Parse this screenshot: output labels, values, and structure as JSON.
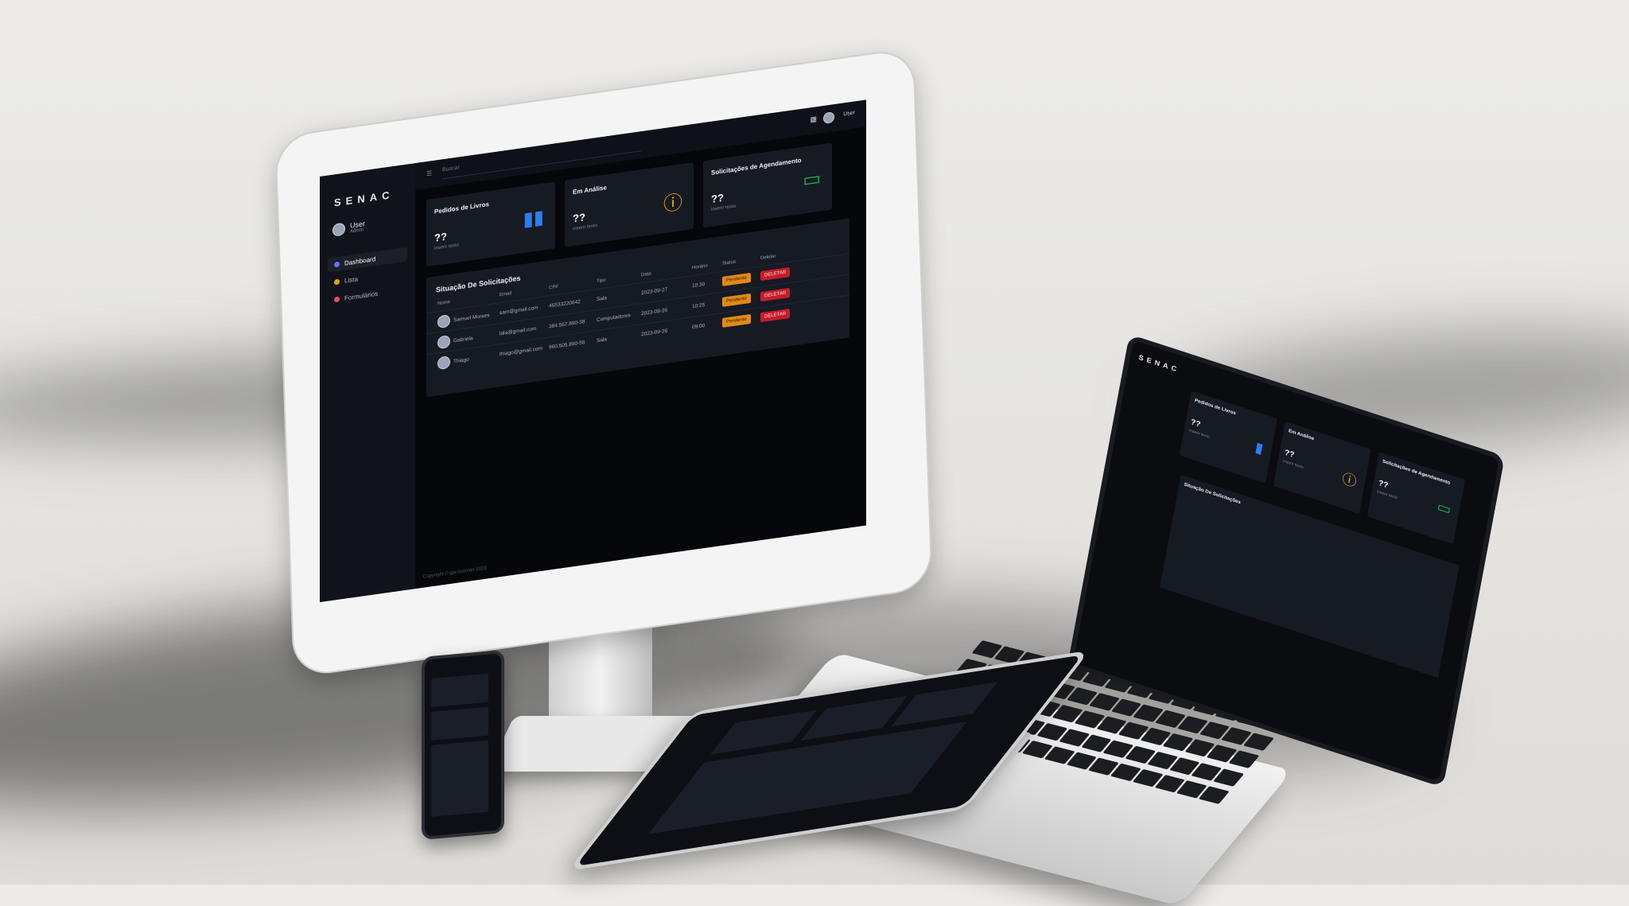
{
  "brand": "SENAC",
  "user": {
    "name": "User",
    "role": "Admin"
  },
  "topbar": {
    "search_placeholder": "Buscar",
    "user_label": "User"
  },
  "nav": [
    {
      "label": "Dashboard",
      "color": "#6b6ef6"
    },
    {
      "label": "Lista",
      "color": "#e0a31a"
    },
    {
      "label": "Formulários",
      "color": "#e0525e"
    }
  ],
  "cards": [
    {
      "title": "Pedidos de Livros",
      "value": "??",
      "sub": "inserir texto",
      "icon": "book-icon",
      "color": "#2f7bf1"
    },
    {
      "title": "Em Análise",
      "value": "??",
      "sub": "inserir texto",
      "icon": "alert-icon",
      "color": "#f2b10f"
    },
    {
      "title": "Solicitações de Agendamento",
      "value": "??",
      "sub": "inserir texto",
      "icon": "monitor-icon",
      "color": "#1fb45a"
    }
  ],
  "table": {
    "title": "Situação De Solicitações",
    "headers": [
      "Nome",
      "Email",
      "CPF",
      "Tipo",
      "Data",
      "Horário",
      "Status",
      "Deletar"
    ],
    "rows": [
      {
        "name": "Samuel Moraes",
        "email": "sam@gmail.com",
        "cpf": "46533220642",
        "tipo": "Sala",
        "data": "2023-09-27",
        "hora": "10:30",
        "status": "Pendente",
        "delete": "DELETAR"
      },
      {
        "name": "Gabriela",
        "email": "lala@gmail.com",
        "cpf": "384.567.890-38",
        "tipo": "Computadores",
        "data": "2023-09-26",
        "hora": "10:25",
        "status": "Pendente",
        "delete": "DELETAR"
      },
      {
        "name": "Thiago",
        "email": "thiago@gmail.com",
        "cpf": "960.505.890-56",
        "tipo": "Sala",
        "data": "2023-09-26",
        "hora": "09:00",
        "status": "Pendente",
        "delete": "DELETAR"
      }
    ]
  },
  "footer": "Copyright © gpr-lozinian 2023"
}
